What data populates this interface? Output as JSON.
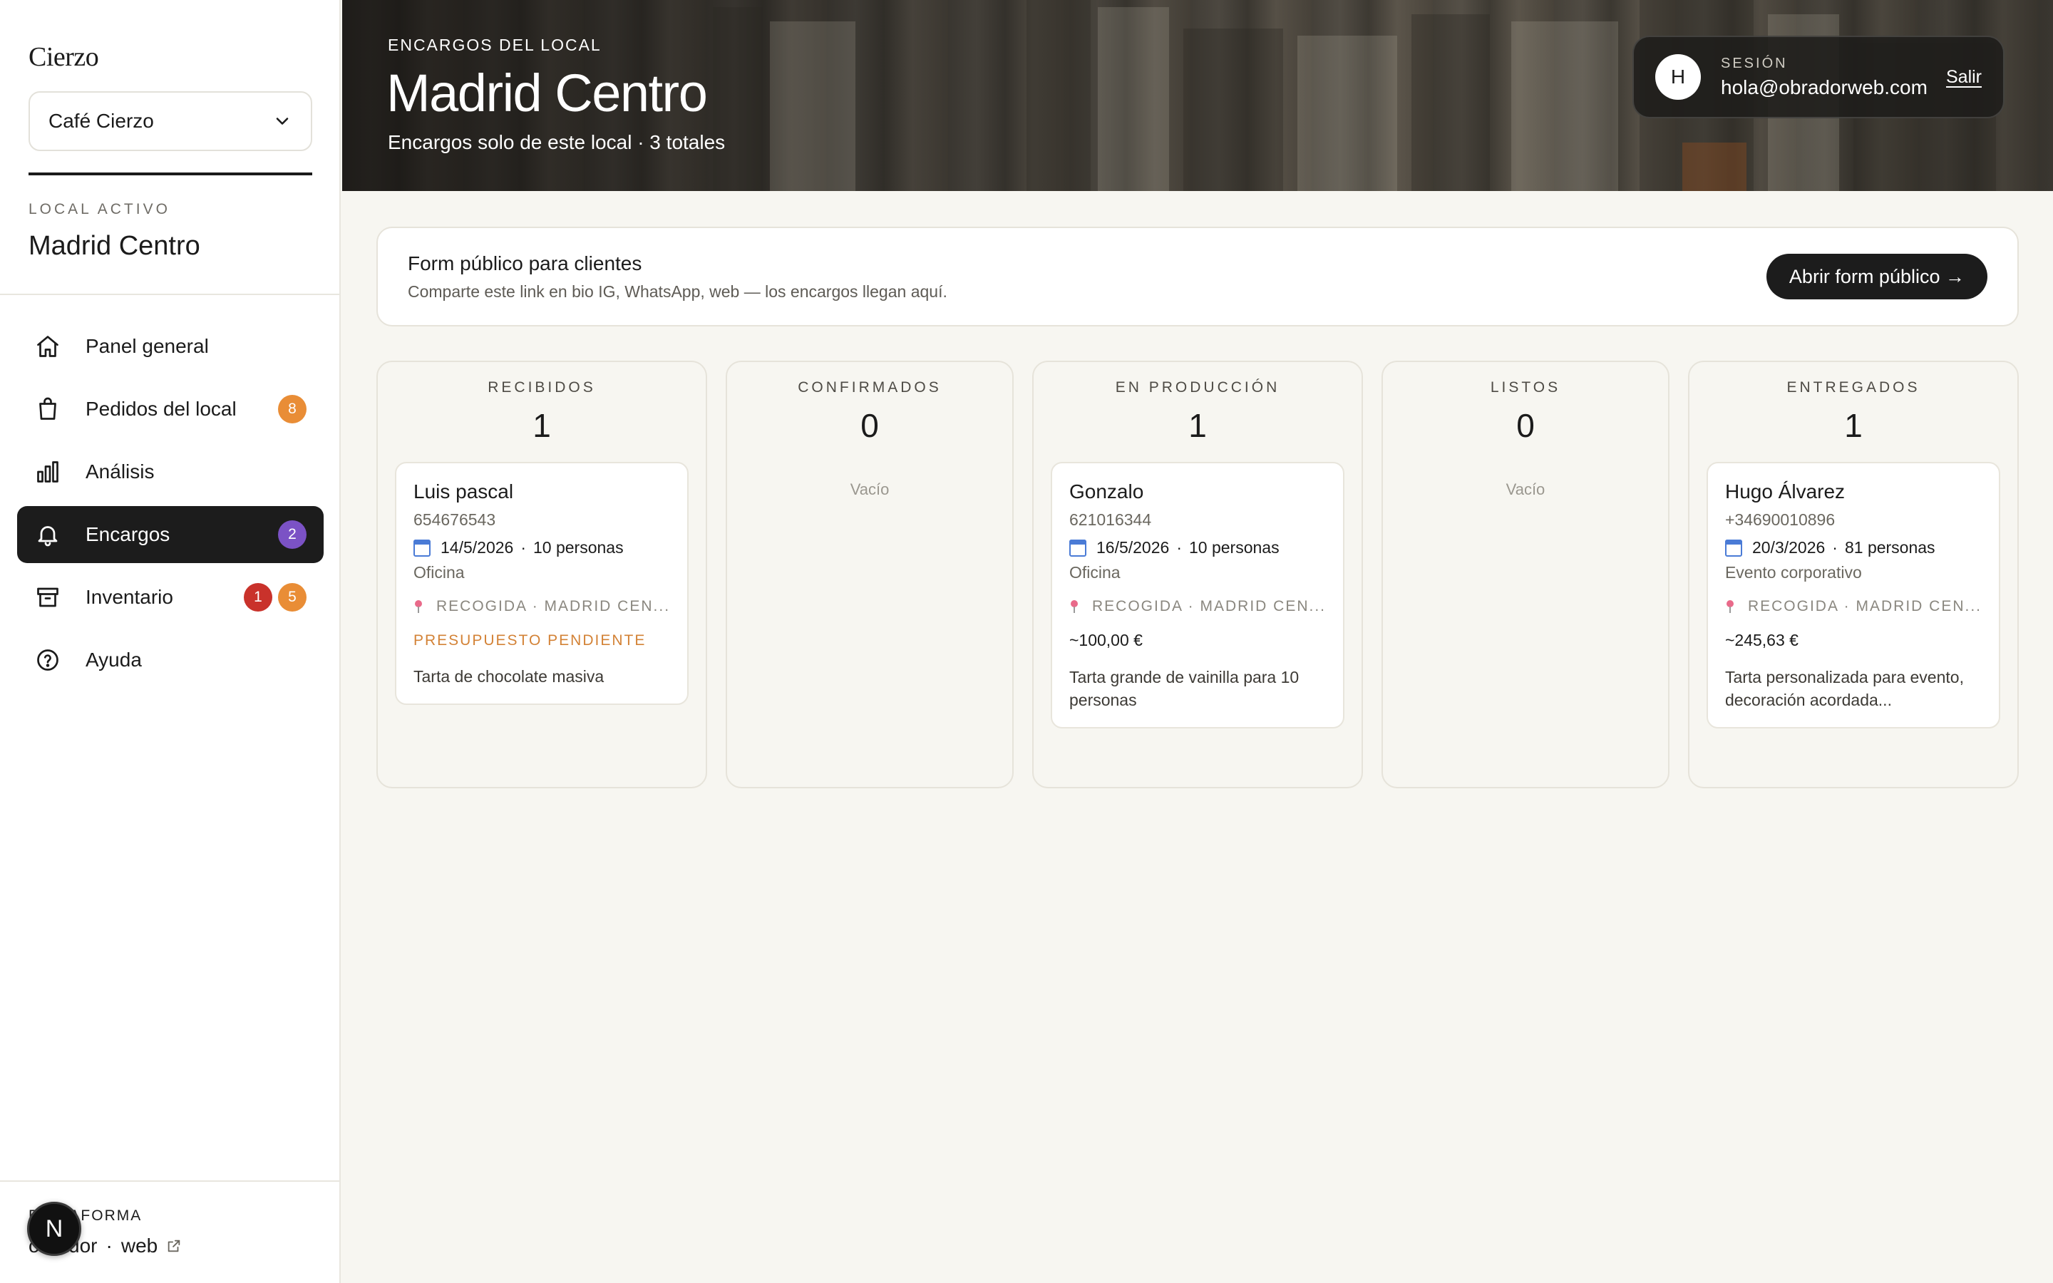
{
  "sidebar": {
    "brand": "Cierzo",
    "store_select": {
      "value": "Café Cierzo",
      "icon": "chevron-down-icon"
    },
    "active_local_label": "LOCAL ACTIVO",
    "active_local_name": "Madrid Centro",
    "nav": [
      {
        "label": "Panel general",
        "icon": "home-icon",
        "badges": []
      },
      {
        "label": "Pedidos del local",
        "icon": "shopping-bag-icon",
        "badges": [
          "8"
        ]
      },
      {
        "label": "Análisis",
        "icon": "bar-chart-icon",
        "badges": []
      },
      {
        "label": "Encargos",
        "icon": "bell-icon",
        "badges": [
          "2"
        ],
        "active": true
      },
      {
        "label": "Inventario",
        "icon": "archive-icon",
        "badges": [
          "1",
          "5"
        ]
      },
      {
        "label": "Ayuda",
        "icon": "help-circle-icon",
        "badges": []
      }
    ],
    "platform_label": "PLATAFORMA",
    "platform_link_a": "obrador",
    "platform_link_sep": "·",
    "platform_link_b": "web",
    "n_badge": "N"
  },
  "hero": {
    "eyebrow": "ENCARGOS DEL LOCAL",
    "title": "Madrid Centro",
    "subtitle": "Encargos solo de este local · 3 totales"
  },
  "session": {
    "avatar": "H",
    "label": "SESIÓN",
    "email": "hola@obradorweb.com",
    "logout": "Salir"
  },
  "public_form": {
    "title": "Form público para clientes",
    "subtitle": "Comparte este link en bio IG, WhatsApp, web — los encargos llegan aquí.",
    "button": "Abrir form público →"
  },
  "columns": [
    {
      "title": "RECIBIDOS",
      "count": "1",
      "cards": [
        {
          "name": "Luis pascal",
          "phone": "654676543",
          "date": "14/5/2026",
          "people": "10 personas",
          "type": "Oficina",
          "pickup": "RECOGIDA · MADRID CEN...",
          "status": "PRESUPUESTO PENDIENTE",
          "desc": "Tarta de chocolate masiva"
        }
      ]
    },
    {
      "title": "CONFIRMADOS",
      "count": "0",
      "empty": "Vacío",
      "cards": []
    },
    {
      "title": "EN PRODUCCIÓN",
      "count": "1",
      "cards": [
        {
          "name": "Gonzalo",
          "phone": "621016344",
          "date": "16/5/2026",
          "people": "10 personas",
          "type": "Oficina",
          "pickup": "RECOGIDA · MADRID CEN...",
          "price": "~100,00 €",
          "desc": "Tarta grande de vainilla para 10 personas"
        }
      ]
    },
    {
      "title": "LISTOS",
      "count": "0",
      "empty": "Vacío",
      "cards": []
    },
    {
      "title": "ENTREGADOS",
      "count": "1",
      "cards": [
        {
          "name": "Hugo Álvarez",
          "phone": "+34690010896",
          "date": "20/3/2026",
          "people": "81 personas",
          "type": "Evento corporativo",
          "pickup": "RECOGIDA · MADRID CEN...",
          "price": "~245,63 €",
          "desc": "Tarta personalizada para evento, decoración acordada..."
        }
      ]
    }
  ],
  "colors": {
    "accent_dark": "#1c1c1c",
    "badge_orange": "#e98d36",
    "badge_purple": "#7b52c5",
    "badge_red": "#c9322b",
    "status_pending": "#d38236"
  }
}
